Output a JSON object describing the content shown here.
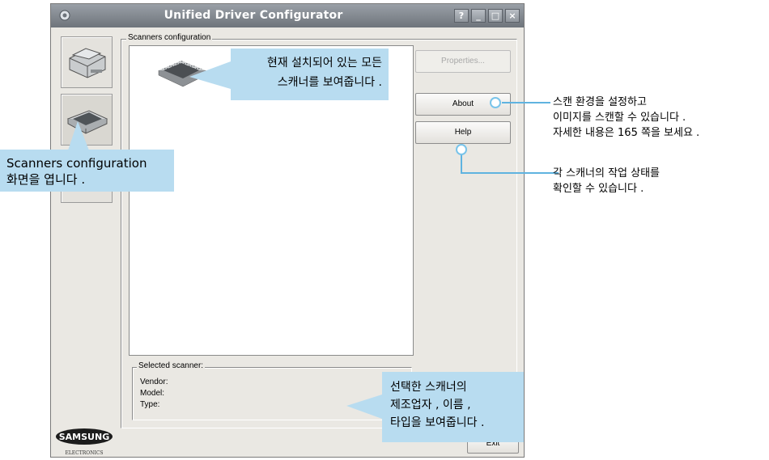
{
  "window": {
    "title": "Unified Driver Configurator",
    "buttons": [
      "?",
      "_",
      "□",
      "×"
    ]
  },
  "sidebar": {
    "items": [
      {
        "name": "printer",
        "icon": "printer-icon"
      },
      {
        "name": "scanner",
        "icon": "scanner-icon"
      },
      {
        "name": "ports",
        "icon": "port-icon"
      }
    ]
  },
  "scanners_group": {
    "label": "Scanners configuration"
  },
  "buttons": {
    "properties": "Properties...",
    "about": "About",
    "help": "Help",
    "exit": "Exit"
  },
  "selected": {
    "label": "Selected scanner:",
    "vendor": "Vendor:",
    "model": "Model:",
    "type": "Type:"
  },
  "brand": {
    "name": "SAMSUNG",
    "sub": "ELECTRONICS"
  },
  "callouts": {
    "list": [
      "현재 설치되어 있는 모든",
      "스캐너를 보여줍니다 ."
    ],
    "open": [
      "Scanners configuration",
      "화면을 엽니다 ."
    ],
    "selected": [
      "선택한 스캐너의",
      "제조업자 , 이름 ,",
      "타입을 보여줍니다 ."
    ],
    "about": [
      "스캔 환경을 설정하고",
      "이미지를 스캔할 수 있습니다 .",
      "자세한 내용은 165 쪽을 보세요 ."
    ],
    "help": [
      "각 스캐너의 작업 상태를",
      "확인할 수 있습니다 ."
    ]
  },
  "colors": {
    "callout_bg": "#b8dcf0",
    "connector": "#5fb3e0"
  }
}
